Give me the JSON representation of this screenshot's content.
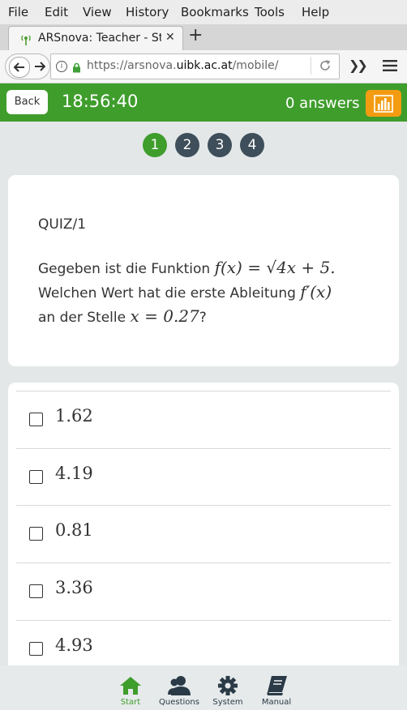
{
  "browser": {
    "menu": [
      "File",
      "Edit",
      "View",
      "History",
      "Bookmarks",
      "Tools",
      "Help"
    ],
    "tab_title": "ARSnova: Teacher - Start",
    "url_prefix": "https://arsnova.",
    "url_domain": "uibk.ac.at",
    "url_suffix": "/mobile/"
  },
  "header": {
    "back_label": "Back",
    "clock": "18:56:40",
    "answers_label": "0 answers",
    "accent": "#3f9d2c",
    "stats_color": "#f39c12"
  },
  "pager": {
    "pages": [
      "1",
      "2",
      "3",
      "4"
    ],
    "active_index": 0
  },
  "question": {
    "label": "QUIZ/1",
    "text_part1": "Gegeben ist die Funktion",
    "math1": "f(x) = √4x + 5.",
    "text_part2": "Welchen Wert hat die erste Ableitung",
    "math2": "f′(x)",
    "text_part3": "an der Stelle",
    "math3": "x = 0.27",
    "text_end": "?"
  },
  "answers": [
    {
      "label": "1.62",
      "checked": false
    },
    {
      "label": "4.19",
      "checked": false
    },
    {
      "label": "0.81",
      "checked": false
    },
    {
      "label": "3.36",
      "checked": false
    },
    {
      "label": "4.93",
      "checked": false
    }
  ],
  "tabbar": {
    "items": [
      {
        "label": "Start",
        "icon": "home-icon"
      },
      {
        "label": "Questions",
        "icon": "users-icon"
      },
      {
        "label": "System",
        "icon": "gear-icon"
      },
      {
        "label": "Manual",
        "icon": "book-icon"
      }
    ],
    "active_index": 0
  }
}
